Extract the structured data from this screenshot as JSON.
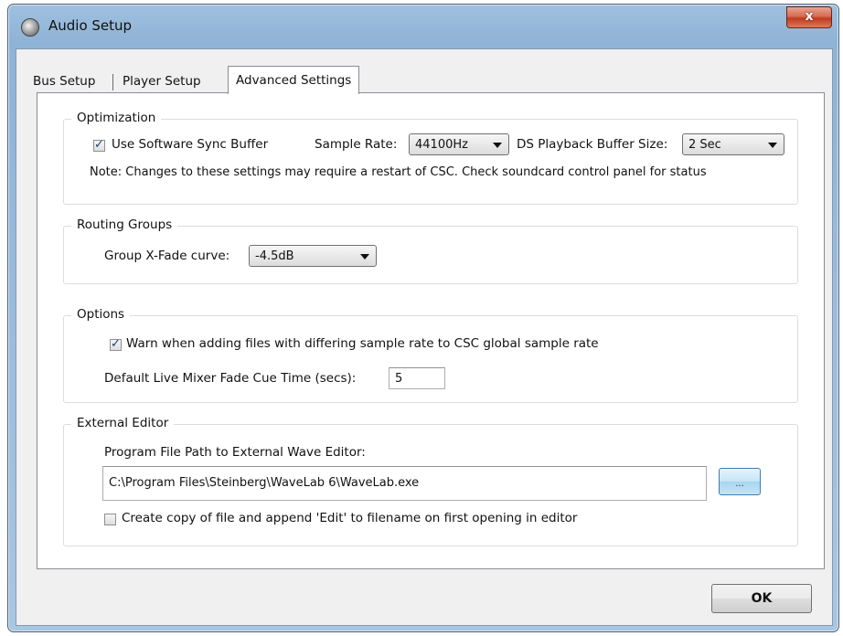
{
  "window": {
    "title": "Audio Setup",
    "close_label": "x"
  },
  "tabs": [
    {
      "label": "Bus Setup"
    },
    {
      "label": "Player Setup"
    },
    {
      "label": "Advanced Settings"
    }
  ],
  "optimization": {
    "title": "Optimization",
    "sync_buffer_label": "Use Software Sync Buffer",
    "sync_buffer_checked": true,
    "sample_rate_label": "Sample Rate:",
    "sample_rate_value": "44100Hz",
    "ds_buffer_label": "DS Playback Buffer Size:",
    "ds_buffer_value": "2 Sec",
    "note": "Note: Changes to these settings may require a restart of CSC. Check soundcard control panel for status"
  },
  "routing": {
    "title": "Routing Groups",
    "xfade_label": "Group X-Fade curve:",
    "xfade_value": "-4.5dB"
  },
  "options": {
    "title": "Options",
    "warn_label": "Warn when adding files with differing sample rate to CSC global sample rate",
    "warn_checked": true,
    "fade_label": "Default Live Mixer Fade Cue Time (secs):",
    "fade_value": "5"
  },
  "editor": {
    "title": "External Editor",
    "path_label": "Program File Path to External Wave Editor:",
    "path_value": "C:\\Program Files\\Steinberg\\WaveLab 6\\WaveLab.exe",
    "browse_label": "...",
    "copy_label": "Create copy of file and append 'Edit' to filename on first opening in editor",
    "copy_checked": false
  },
  "ok_label": "OK"
}
